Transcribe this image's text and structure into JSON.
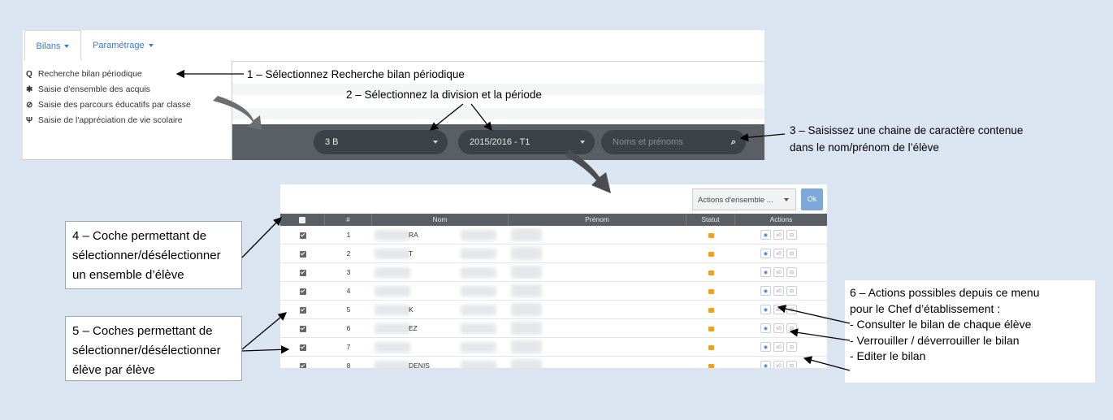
{
  "nav": {
    "tabs": [
      {
        "label": "Bilans"
      },
      {
        "label": "Paramétrage"
      }
    ]
  },
  "menu": {
    "items": [
      {
        "icon": "search-icon",
        "glyph": "Q",
        "label": "Recherche bilan périodique"
      },
      {
        "icon": "users-icon",
        "glyph": "✱",
        "label": "Saisie d'ensemble des acquis"
      },
      {
        "icon": "compass-icon",
        "glyph": "⊘",
        "label": "Saisie des parcours éducatifs par classe"
      },
      {
        "icon": "fork-icon",
        "glyph": "Ψ",
        "label": "Saisie de l'appréciation de vie scolaire"
      }
    ]
  },
  "filters": {
    "division": "3 B",
    "period": "2015/2016 - T1",
    "search_placeholder": "Noms et prénoms"
  },
  "annotations": {
    "a1": "1 – Sélectionnez Recherche bilan périodique",
    "a2": "2 – Sélectionnez la division et la période",
    "a3_l1": "3 – Saisissez une chaine de caractère contenue",
    "a3_l2": "dans le nom/prénom de l’élève",
    "a4_l1": "4  – Coche permettant de",
    "a4_l2": "sélectionner/désélectionner",
    "a4_l3": "un ensemble d’élève",
    "a5_l1": "5  – Coches permettant de",
    "a5_l2": "sélectionner/désélectionner",
    "a5_l3": "élève par élève",
    "a6_l1": "6 – Actions possibles depuis ce menu",
    "a6_l2": "pour le Chef d’établissement :",
    "a6_l3": "-   Consulter le bilan de chaque élève",
    "a6_l4": "-   Verrouiller / déverrouiller le bilan",
    "a6_l5": "-   Editer le bilan"
  },
  "table": {
    "bulk_actions": "Actions d'ensemble ...",
    "ok": "Ok",
    "headers": {
      "num": "#",
      "nom": "Nom",
      "prenom": "Prénom",
      "statut": "Statut",
      "actions": "Actions"
    },
    "rows": [
      {
        "num": "1",
        "nom": "RA"
      },
      {
        "num": "2",
        "nom": "T"
      },
      {
        "num": "3",
        "nom": ""
      },
      {
        "num": "4",
        "nom": ""
      },
      {
        "num": "5",
        "nom": "K"
      },
      {
        "num": "6",
        "nom": "EZ"
      },
      {
        "num": "7",
        "nom": ""
      },
      {
        "num": "8",
        "nom": "DENIS"
      }
    ],
    "action_labels": {
      "view": "◉",
      "version": "v0",
      "print": "⊟"
    }
  },
  "colors": {
    "accent": "#3a7bd5",
    "dark_bar": "#5a5f66",
    "lock": "#f0a020",
    "background": "#dbe4f1"
  }
}
